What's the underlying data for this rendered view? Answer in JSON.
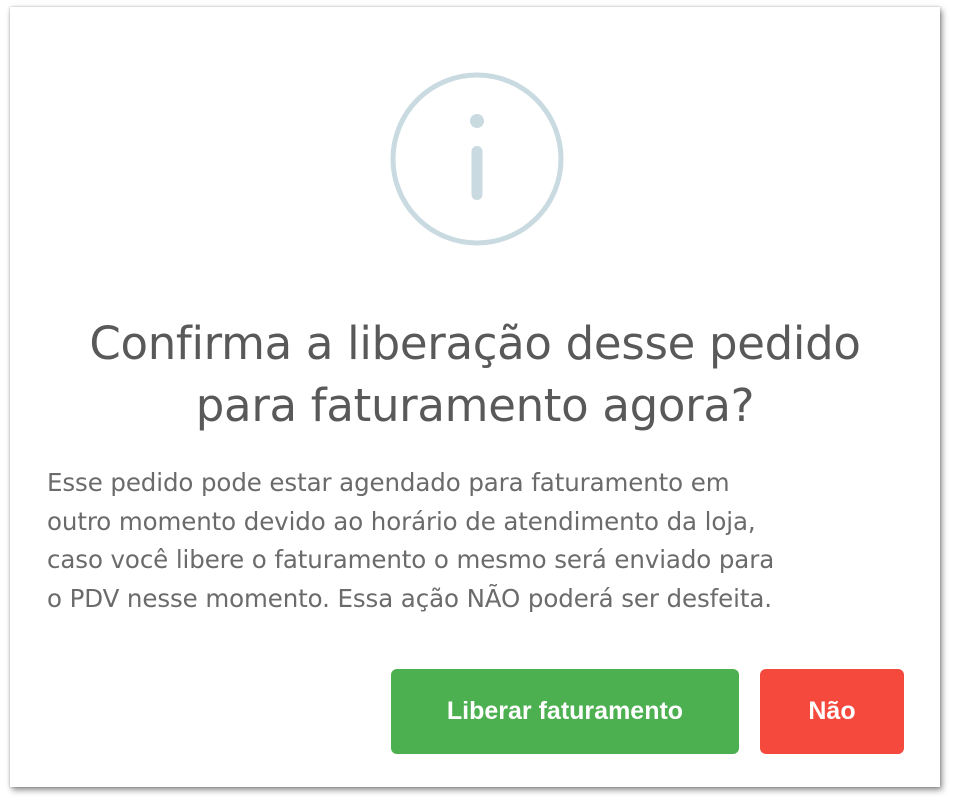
{
  "dialog": {
    "icon": "info-circle-icon",
    "icon_color": "#c9dae1",
    "title_line1": "Confirma a liberação desse pedido",
    "title_line2": "para faturamento agora?",
    "message_lines": [
      "Esse pedido pode estar agendado para faturamento em",
      "outro momento devido ao horário de atendimento da loja,",
      "caso você libere o faturamento o mesmo será enviado para",
      "o PDV nesse momento. Essa ação NÃO poderá ser desfeita."
    ],
    "confirm_label": "Liberar faturamento",
    "cancel_label": "Não",
    "confirm_color": "#4caf50",
    "cancel_color": "#f4493c"
  }
}
